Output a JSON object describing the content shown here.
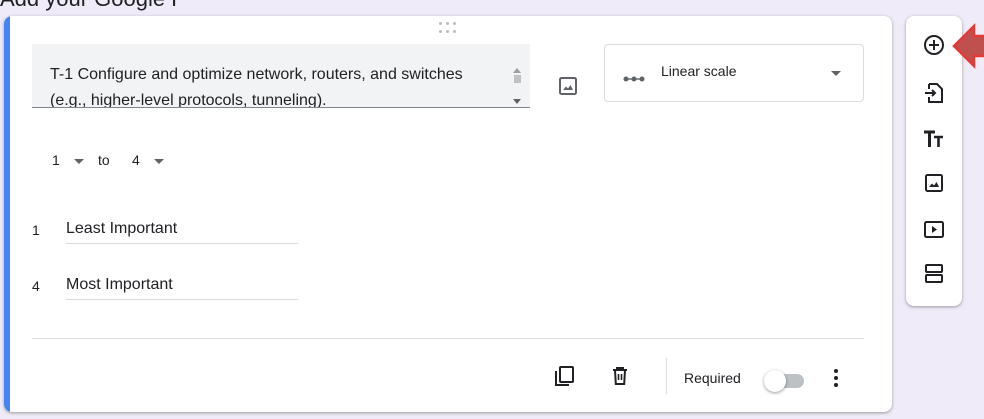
{
  "caption": "Add your Google F",
  "question": {
    "text": "T-1 Configure and optimize network, routers, and switches (e.g., higher-level protocols, tunneling)."
  },
  "type_select": {
    "icon": "linear-scale-icon",
    "label": "Linear scale"
  },
  "scale": {
    "from": "1",
    "to_word": "to",
    "to": "4",
    "low_num": "1",
    "low_label": "Least Important",
    "high_num": "4",
    "high_label": "Most Important"
  },
  "footer": {
    "required_label": "Required",
    "required_on": false
  },
  "toolbar": {
    "items": [
      "add-question-icon",
      "import-questions-icon",
      "add-title-icon",
      "add-image-icon",
      "add-video-icon",
      "add-section-icon"
    ]
  },
  "colors": {
    "accent": "#4285f4",
    "background": "#f0ebf8",
    "pointer": "#e53935"
  }
}
